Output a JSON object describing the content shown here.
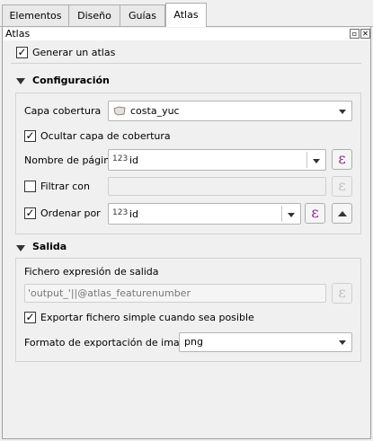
{
  "tabs": [
    {
      "label": "Elementos",
      "active": false
    },
    {
      "label": "Diseño",
      "active": false
    },
    {
      "label": "Guías",
      "active": false
    },
    {
      "label": "Atlas",
      "active": true
    }
  ],
  "panel": {
    "title": "Atlas",
    "float_icon": "float-icon",
    "close_icon": "close-icon"
  },
  "generar": {
    "label": "Generar un atlas",
    "checked": true
  },
  "configuracion": {
    "header": "Configuración",
    "capa_label": "Capa cobertura",
    "capa_value": "costa_yuc",
    "capa_icon": "polygon-layer-icon",
    "ocultar": {
      "label": "Ocultar capa de cobertura",
      "checked": true
    },
    "nombre_label": "Nombre de página",
    "nombre_type": "123",
    "nombre_value": "id",
    "filtrar": {
      "label": "Filtrar con",
      "checked": false
    },
    "ordenar": {
      "label": "Ordenar por",
      "checked": true
    },
    "ordenar_type": "123",
    "ordenar_value": "id",
    "expression_symbol": "ε",
    "sort_icon": "sort-ascending-icon"
  },
  "salida": {
    "header": "Salida",
    "fichero_label": "Fichero expresión de salida",
    "fichero_value": "'output_'||@atlas_featurenumber",
    "exportar": {
      "label": "Exportar fichero simple cuando sea posible",
      "checked": true
    },
    "formato_label": "Formato de exportación de imagen",
    "formato_value": "png"
  },
  "colors": {
    "accent": "#8a2a8a",
    "background": "#f0f0f0"
  }
}
